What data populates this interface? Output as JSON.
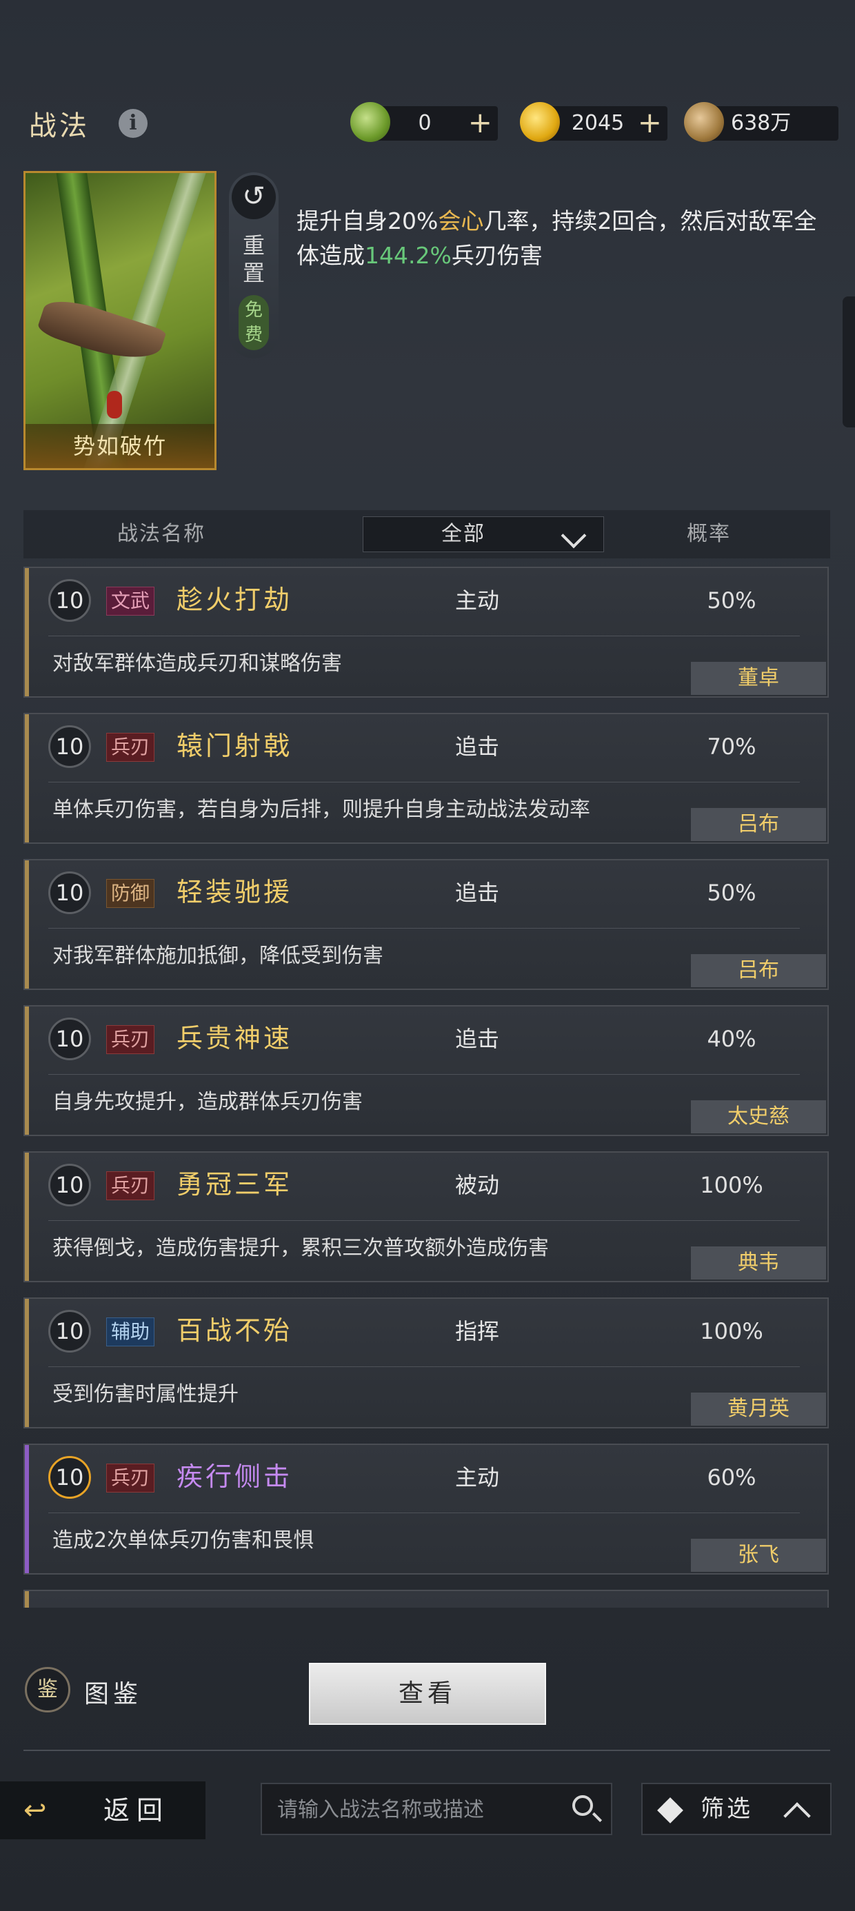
{
  "header": {
    "title": "战法",
    "currencies": [
      {
        "icon": "jade-coin-icon",
        "value": "0"
      },
      {
        "icon": "gold-coin-icon",
        "value": "2045"
      },
      {
        "icon": "copper-coin-icon",
        "value": "638万"
      }
    ]
  },
  "skill": {
    "card_name": "势如破竹",
    "reset_label": "重置",
    "free_label": "免费",
    "desc_part1": "提升自身20%",
    "desc_hl1": "会心",
    "desc_part2": "几率，持续2回合，然后对敌军全体造成",
    "desc_hl2": "144.2%",
    "desc_part3": "兵刃伤害"
  },
  "table": {
    "col_name": "战法名称",
    "filter_value": "全部",
    "col_rate": "概率"
  },
  "rows": [
    {
      "level": "10",
      "tag": "文武",
      "name": "趁火打劫",
      "type": "主动",
      "rate": "50%",
      "desc": "对敌军群体造成兵刃和谋略伤害",
      "general": "董卓"
    },
    {
      "level": "10",
      "tag": "兵刃",
      "name": "辕门射戟",
      "type": "追击",
      "rate": "70%",
      "desc": "单体兵刃伤害，若自身为后排，则提升自身主动战法发动率",
      "general": "吕布"
    },
    {
      "level": "10",
      "tag": "防御",
      "name": "轻装驰援",
      "type": "追击",
      "rate": "50%",
      "desc": "对我军群体施加抵御，降低受到伤害",
      "general": "吕布"
    },
    {
      "level": "10",
      "tag": "兵刃",
      "name": "兵贵神速",
      "type": "追击",
      "rate": "40%",
      "desc": "自身先攻提升，造成群体兵刃伤害",
      "general": "太史慈"
    },
    {
      "level": "10",
      "tag": "兵刃",
      "name": "勇冠三军",
      "type": "被动",
      "rate": "100%",
      "desc": "获得倒戈，造成伤害提升，累积三次普攻额外造成伤害",
      "general": "典韦"
    },
    {
      "level": "10",
      "tag": "辅助",
      "name": "百战不殆",
      "type": "指挥",
      "rate": "100%",
      "desc": "受到伤害时属性提升",
      "general": "黄月英"
    },
    {
      "level": "10",
      "tag": "兵刃",
      "name": "疾行侧击",
      "type": "主动",
      "rate": "60%",
      "desc": "造成2次单体兵刃伤害和畏惧",
      "general": "张飞"
    }
  ],
  "bottom": {
    "codex_icon_char": "鉴",
    "codex_label": "图鉴",
    "view_button": "查看",
    "back_label": "返回",
    "search_placeholder": "请输入战法名称或描述",
    "filter_label": "筛选"
  },
  "colors": {
    "accent_gold": "#e9b850",
    "accent_green": "#68c87a",
    "name_gold": "#f0cd6a",
    "name_purple": "#c58af0"
  }
}
